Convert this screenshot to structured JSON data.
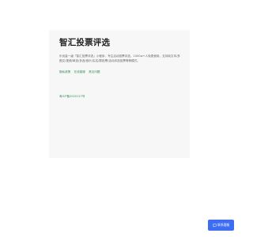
{
  "card": {
    "title": "智汇投票评选",
    "description": "乐优量一级「智汇投票评选」小程序，专注活动投票评选，1000w+人免费使用，支持纯文本/多图文/视频/单选/多选/音乐/实名/群投票/活动评选投票等等模式。",
    "links": [
      {
        "label": "隐私政策"
      },
      {
        "label": "在线客服"
      },
      {
        "label": "常见问题"
      }
    ],
    "icp": "粤ICP备2020127号"
  },
  "fab": {
    "icon": "chat-bubble-icon",
    "label": "联系客服"
  },
  "colors": {
    "card_bg": "#f7f7f7",
    "link": "#3a8f5a",
    "fab_bg": "#3d6df2"
  }
}
